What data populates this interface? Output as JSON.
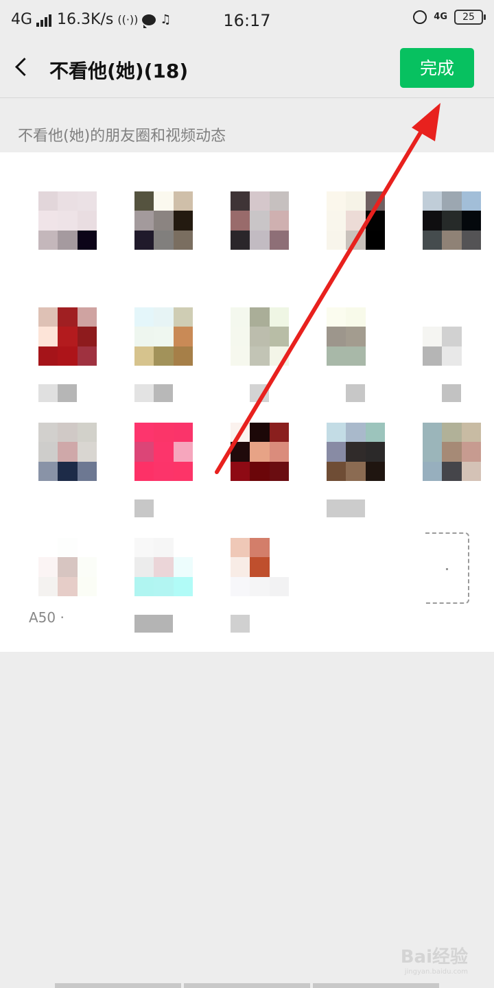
{
  "status_bar": {
    "network": "4G",
    "speed": "16.3K/s",
    "time": "16:17",
    "net_type": "4G",
    "battery": "25"
  },
  "header": {
    "title": "不看他(她)(18)",
    "done_label": "完成"
  },
  "subtitle": "不看他(她)的朋友圈和视频动态",
  "contacts": [
    {
      "colors": [
        "#e2d6da",
        "#eadfe3",
        "#ebe1e5",
        "#f0e4e8",
        "#eee3e7",
        "#e9dde1",
        "#c4b7bb",
        "#a59a9f",
        "#0c0418"
      ],
      "name": []
    },
    {
      "colors": [
        "#55533f",
        "#fbf9ef",
        "#cfbfa9",
        "#a39a9c",
        "#8b8481",
        "#231a10",
        "#201a2b",
        "#817f7d",
        "#7a6e60"
      ],
      "name": []
    },
    {
      "colors": [
        "#3f3436",
        "#d5c7cb",
        "#c6c0bf",
        "#996b6b",
        "#c9c5c7",
        "#cfb0b0",
        "#2a262a",
        "#c2bbc2",
        "#8e6f77"
      ],
      "name": []
    },
    {
      "colors": [
        "#fbf7ec",
        "#f6f3e7",
        "#6f6061",
        "#f9f6ec",
        "#ecdbd6",
        "#020202",
        "#f8f5eb",
        "#c9c2bc",
        "#000000"
      ],
      "name": []
    },
    {
      "colors": [
        "#c0cdd8",
        "#9ca7b1",
        "#a2bed8",
        "#0f0e10",
        "#262a29",
        "#04080c",
        "#454c4e",
        "#8f8276",
        "#545355"
      ],
      "name": []
    },
    {
      "colors": [
        "#dec1b5",
        "#a01f22",
        "#cfa3a1",
        "#fde4d8",
        "#b31b1e",
        "#8e1b1d",
        "#a51419",
        "#ad1419",
        "#9f3240"
      ],
      "name": [
        "#e0e0e0",
        "#b6b6b6"
      ]
    },
    {
      "colors": [
        "#e4f6fa",
        "#e7f4f5",
        "#cfcdb4",
        "#eef6ef",
        "#eff7f0",
        "#c98a56",
        "#d6c38d",
        "#a2925a",
        "#a67f48"
      ],
      "name": [
        "#e3e3e3",
        "#b8b8b8"
      ]
    },
    {
      "colors": [
        "#f4f8ee",
        "#aaae98",
        "#eff6e4",
        "#f5f8ee",
        "#bcbdad",
        "#b8bda6",
        "#f6f8ee",
        "#c2c4b5",
        "#f3f5e8"
      ],
      "name": [
        "#ffffff",
        "#d3d3d3"
      ]
    },
    {
      "colors": [
        "#fbfcef",
        "#f8faea",
        "#ffffff",
        "#9d968c",
        "#a39c8f",
        "#ffffff",
        "#a8b8a8",
        "#a8b8a8",
        "#ffffff"
      ],
      "name": [
        "#ffffff",
        "#c7c7c7"
      ]
    },
    {
      "colors": [
        "#ffffff",
        "#ffffff",
        "#ffffff",
        "#f5f5f2",
        "#d1d1d1",
        "#ffffff",
        "#b5b5b5",
        "#e8e8e8",
        "#ffffff"
      ],
      "name": [
        "#ffffff",
        "#c2c2c2"
      ]
    },
    {
      "colors": [
        "#d2d0cd",
        "#d0c9c6",
        "#d2d1ca",
        "#cecdcb",
        "#cfa8a9",
        "#d9d6d1",
        "#8993a7",
        "#1d2b48",
        "#6d7892"
      ],
      "name": []
    },
    {
      "colors": [
        "#fd356d",
        "#fb3569",
        "#fa346a",
        "#dc4577",
        "#fc356b",
        "#f6a6bd",
        "#fd3167",
        "#fc346a",
        "#fd3468"
      ],
      "name": [
        "#c7c7c7",
        "#ffffff"
      ]
    },
    {
      "colors": [
        "#fbf2ee",
        "#1c0808",
        "#8a1f1e",
        "#200a0b",
        "#e7a386",
        "#da8c7c",
        "#8e0a14",
        "#6b0609",
        "#6a0d11"
      ],
      "name": []
    },
    {
      "colors": [
        "#c3dce5",
        "#a9b9cb",
        "#9cc4bc",
        "#888ba4",
        "#302b2a",
        "#2b2929",
        "#6f4d35",
        "#8b6b52",
        "#1f1510"
      ],
      "name": [
        "#cccccc",
        "#cccccc"
      ]
    },
    {
      "colors": [
        "#9bb5ba",
        "#b1b198",
        "#c8bba3",
        "#9bb5ba",
        "#a68a76",
        "#c79b90",
        "#97afbe",
        "#45454a",
        "#d4c2b6"
      ],
      "name": []
    },
    {
      "colors": [
        "#ffffff",
        "#fdfefd",
        "#ffffff",
        "#fbf4f4",
        "#d7c5c1",
        "#fbfdf8",
        "#f4f2f0",
        "#e6cdc8",
        "#fbfdf6"
      ],
      "name": []
    },
    {
      "colors": [
        "#f8f8f8",
        "#f6f6f6",
        "#ffffff",
        "#ececec",
        "#ebd5d8",
        "#edfdfd",
        "#b0f5f1",
        "#b2f5f2",
        "#b1fbf7"
      ],
      "name": [
        "#b4b4b4",
        "#b4b4b4"
      ]
    },
    {
      "colors": [
        "#efc8b7",
        "#d37e6a",
        "#ffffff",
        "#f8ece6",
        "#bf4f2d",
        "#ffffff",
        "#f7f7fa",
        "#f5f5f6",
        "#f2f2f3"
      ],
      "name": [
        "#d0d0d0",
        "#ffffff"
      ]
    }
  ],
  "partial_label": "A50 ·",
  "watermark": {
    "brand": "Bai经验",
    "url": "jingyan.baidu.com"
  },
  "annotation_color": "#e8211e"
}
